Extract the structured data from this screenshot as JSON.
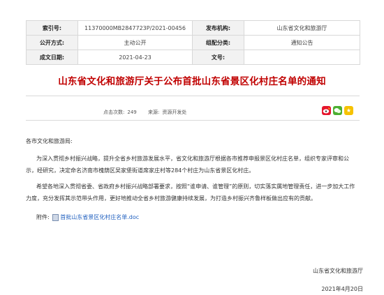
{
  "meta": {
    "index_label": "索引号:",
    "index_value": "11370000MB2847723P/2021-00456",
    "issuer_label": "发布机构:",
    "issuer_value": "山东省文化和旅游厅",
    "open_label": "公开方式:",
    "open_value": "主动公开",
    "category_label": "组配分类:",
    "category_value": "通知公告",
    "date_label": "成文日期:",
    "date_value": "2021-04-23",
    "docno_label": "文号:",
    "docno_value": ""
  },
  "title": "山东省文化和旅游厅关于公布首批山东省景区化村庄名单的通知",
  "info": {
    "hits_label": "点击次数:",
    "hits_value": "249",
    "source_label": "来源:",
    "source_value": "资源开发处"
  },
  "share": {
    "weibo_icon": "weibo-icon",
    "wechat_icon": "wechat-icon",
    "favorite_icon": "star-icon"
  },
  "body": {
    "greeting": "各市文化和旅游局:",
    "para1": "为深入贯彻乡村振兴战略，提升全省乡村旅游发展水平，省文化和旅游厅根据各市推荐申报景区化村庄名单，组织专家评审和公示，经研究，决定命名济南市槐荫区吴家堡街道席家庄村等284个村庄为山东省景区化村庄。",
    "para2": "希望各地深入贯彻省委、省政府乡村振兴战略部署要求，按照“谁申请、谁管理”的原则，切实落实属地管理责任，进一步加大工作力度，充分发挥其示范带头作用，更好地推动全省乡村旅游健康持续发展，为打造乡村振兴齐鲁样板做出应有的贡献。",
    "attach_label": "附件:",
    "attach_link": "首批山东省景区化村庄名单.doc"
  },
  "footer": {
    "signature": "山东省文化和旅游厅",
    "date": "2021年4月20日"
  }
}
